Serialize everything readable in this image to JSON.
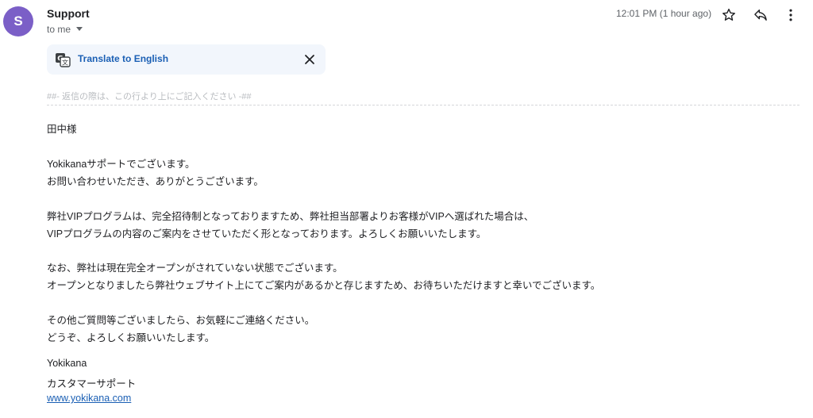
{
  "header": {
    "avatar_initial": "S",
    "avatar_color": "#7b5fc7",
    "sender_name": "Support",
    "recipient_label": "to me",
    "timestamp": "12:01 PM (1 hour ago)",
    "icons": [
      "star-icon",
      "reply-icon",
      "more-vert-icon"
    ]
  },
  "translate": {
    "label": "Translate to English",
    "icon": "translate-icon",
    "close_icon": "close-icon"
  },
  "message": {
    "reply_marker": "##- 返信の際は、この行より上にご記入ください -##",
    "lines": [
      "田中様",
      "Yokikanaサポートでございます。",
      "お問い合わせいただき、ありがとうございます。",
      "弊社VIPプログラムは、完全招待制となっておりますため、弊社担当部署よりお客様がVIPへ選ばれた場合は、",
      "VIPプログラムの内容のご案内をさせていただく形となっております。よろしくお願いいたします。",
      "なお、弊社は現在完全オープンがされていない状態でございます。",
      "オープンとなりましたら弊社ウェブサイト上にてご案内があるかと存じますため、お待ちいただけますと幸いでございます。",
      "その他ご質問等ございましたら、お気軽にご連絡ください。",
      "どうぞ、よろしくお願いいたします。",
      "Yokikana",
      "カスタマーサポート"
    ],
    "link": "www.yokikana.com"
  },
  "colors": {
    "link": "#1a5fb4",
    "translate_bg": "#f2f6fc",
    "muted": "#5f6368"
  }
}
